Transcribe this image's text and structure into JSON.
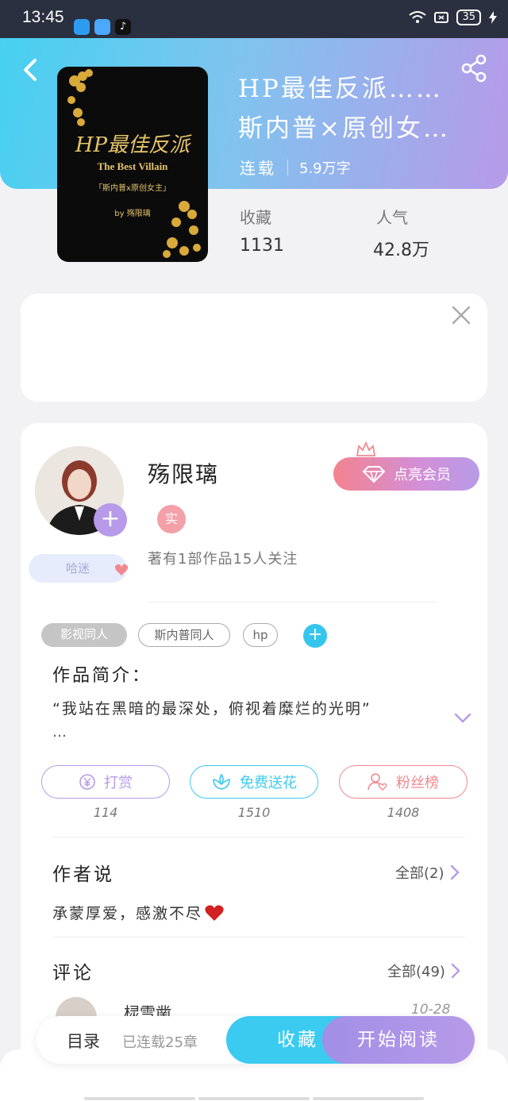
{
  "status_bar": {
    "time": "13:45",
    "battery": "35"
  },
  "book": {
    "title_line1": "HP最佳反派……",
    "title_line2": "斯内普×原创女…",
    "status": "连载",
    "word_count": "5.9万字",
    "stats": [
      {
        "label": "收藏",
        "value": "1131"
      },
      {
        "label": "人气",
        "value": "42.8万"
      }
    ],
    "cover": {
      "title": "HP最佳反派",
      "subtitle": "The Best Villain",
      "tagline": "「斯内普x原创女主」",
      "byline": "by 殇限璃"
    }
  },
  "author": {
    "name": "殇限璃",
    "verified_badge": "实",
    "fan_badge": "哈迷",
    "stats_text": "著有1部作品15人关注",
    "vip_button": "点亮会员"
  },
  "tags": [
    "影视同人",
    "斯内普同人",
    "hp"
  ],
  "intro": {
    "title": "作品简介：",
    "text": "“我站在黑暗的最深处，俯视着糜烂的光明”",
    "more": "…"
  },
  "actions": [
    {
      "label": "打赏",
      "count": "114",
      "color": "#b79ae9"
    },
    {
      "label": "免费送花",
      "count": "1510",
      "color": "#3ccbf0"
    },
    {
      "label": "粉丝榜",
      "count": "1408",
      "color": "#f0898f"
    }
  ],
  "author_says": {
    "title": "作者说",
    "more": "全部(2)",
    "text": "承蒙厚爱，感激不尽"
  },
  "comments": {
    "title": "评论",
    "more": "全部(49)",
    "first": {
      "name": "棂雪凿",
      "date": "10-28"
    }
  },
  "bottom_bar": {
    "catalog": "目录",
    "chapters": "已连载25章",
    "collect": "收藏",
    "read": "开始阅读"
  }
}
